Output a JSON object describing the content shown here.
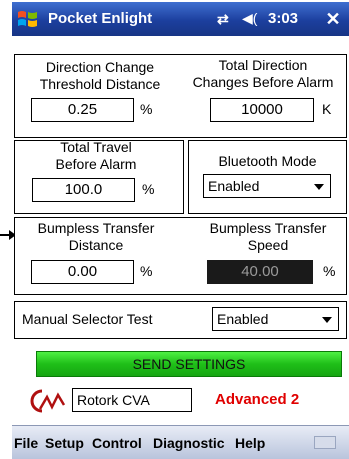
{
  "titlebar": {
    "app_title": "Pocket Enlight",
    "clock": "3:03",
    "close_glyph": "✕"
  },
  "fields": {
    "dir_change": {
      "label_line1": "Direction Change",
      "label_line2": "Threshold Distance",
      "value": "0.25",
      "unit": "%"
    },
    "total_dir": {
      "label_line1": "Total Direction",
      "label_line2": "Changes Before Alarm",
      "value": "10000",
      "unit": "K"
    },
    "total_travel": {
      "label_line1": "Total Travel",
      "label_line2": "Before Alarm",
      "value": "100.0",
      "unit": "%"
    },
    "bluetooth": {
      "label": "Bluetooth Mode",
      "value": "Enabled"
    },
    "bump_dist": {
      "label_line1": "Bumpless Transfer",
      "label_line2": "Distance",
      "value": "0.00",
      "unit": "%"
    },
    "bump_speed": {
      "label_line1": "Bumpless Transfer",
      "label_line2": "Speed",
      "value": "40.00",
      "unit": "%"
    },
    "manual_selector": {
      "label": "Manual Selector Test",
      "value": "Enabled"
    }
  },
  "send_button": "SEND SETTINGS",
  "company": "Rotork CVA",
  "mode": "Advanced 2",
  "menu": [
    "File",
    "Setup",
    "Control",
    "Diagnostic",
    "Help"
  ],
  "colors": {
    "titlebar": "#1c3f9e",
    "send_button": "#22c41b",
    "mode_text": "#e00000",
    "disabled_field": "#1a1a1a"
  },
  "icons": {
    "start": "windows-flag-icon",
    "connectivity": "connectivity-icon",
    "volume": "speaker-icon",
    "logo": "rotork-logo-icon",
    "keyboard": "keyboard-icon"
  }
}
